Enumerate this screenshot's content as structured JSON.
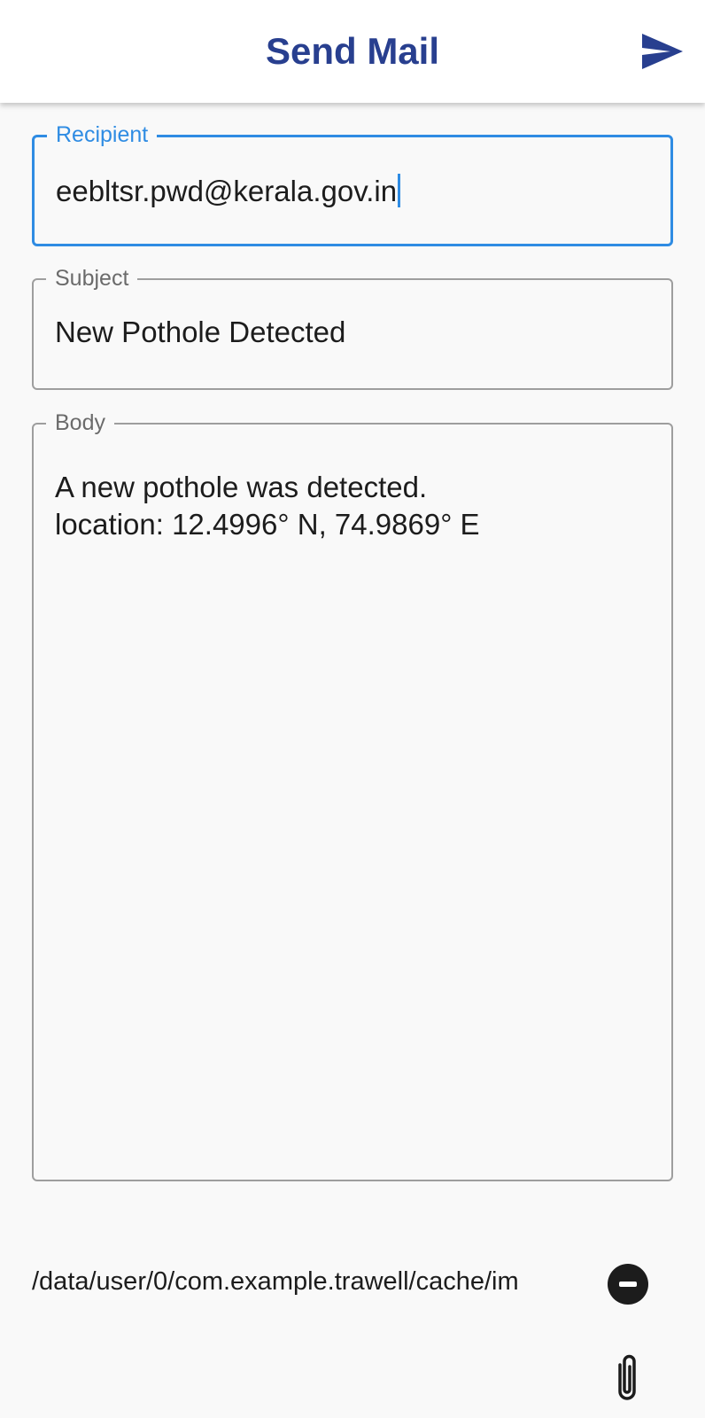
{
  "appbar": {
    "title": "Send Mail",
    "send_icon": "send-icon"
  },
  "form": {
    "recipient": {
      "label": "Recipient",
      "value": "eebltsr.pwd@kerala.gov.in"
    },
    "subject": {
      "label": "Subject",
      "value": "New Pothole Detected"
    },
    "body": {
      "label": "Body",
      "value": "A new pothole was detected.\nlocation: 12.4996° N, 74.9869° E"
    }
  },
  "attachment": {
    "path": "/data/user/0/com.example.trawell/cache/im",
    "remove_icon": "remove-circle-icon",
    "attach_icon": "paperclip-icon"
  },
  "colors": {
    "title": "#283f8f",
    "focus": "#2f8ce3",
    "border": "#9e9e9e",
    "background": "#f9f9f9"
  }
}
